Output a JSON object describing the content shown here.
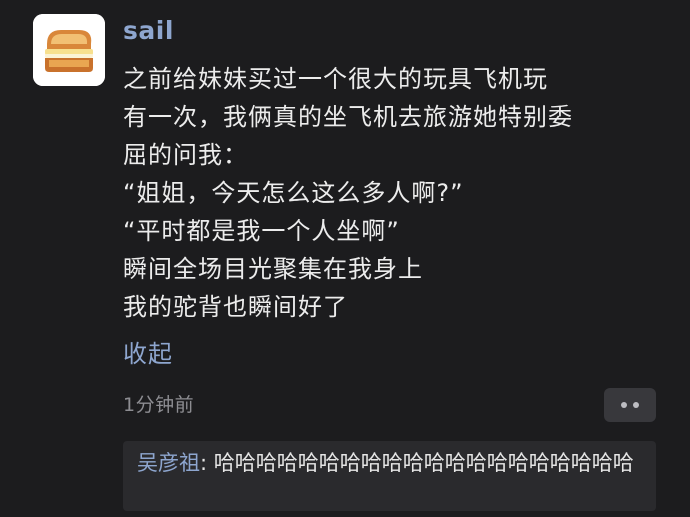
{
  "post": {
    "username": "sail",
    "avatar_icon": "toast-sandwich-icon",
    "lines": [
      "之前给妹妹买过一个很大的玩具飞机玩",
      "有一次，我俩真的坐飞机去旅游她特别委",
      "屈的问我：",
      "“姐姐，今天怎么这么多人啊?”",
      "“平时都是我一个人坐啊”",
      "瞬间全场目光聚集在我身上",
      "我的驼背也瞬间好了"
    ],
    "collapse_label": "收起",
    "timestamp": "1分钟前",
    "more_icon": "more-dots-icon"
  },
  "comments": [
    {
      "author": "吴彦祖",
      "separator": ": ",
      "text": "哈哈哈哈哈哈哈哈哈哈哈哈哈哈哈哈哈哈哈哈"
    }
  ],
  "colors": {
    "background": "#1c1c1e",
    "username": "#8ea6cf",
    "text": "#ececec",
    "muted": "#8d8d92",
    "comment_bg": "#2a2a2d"
  }
}
